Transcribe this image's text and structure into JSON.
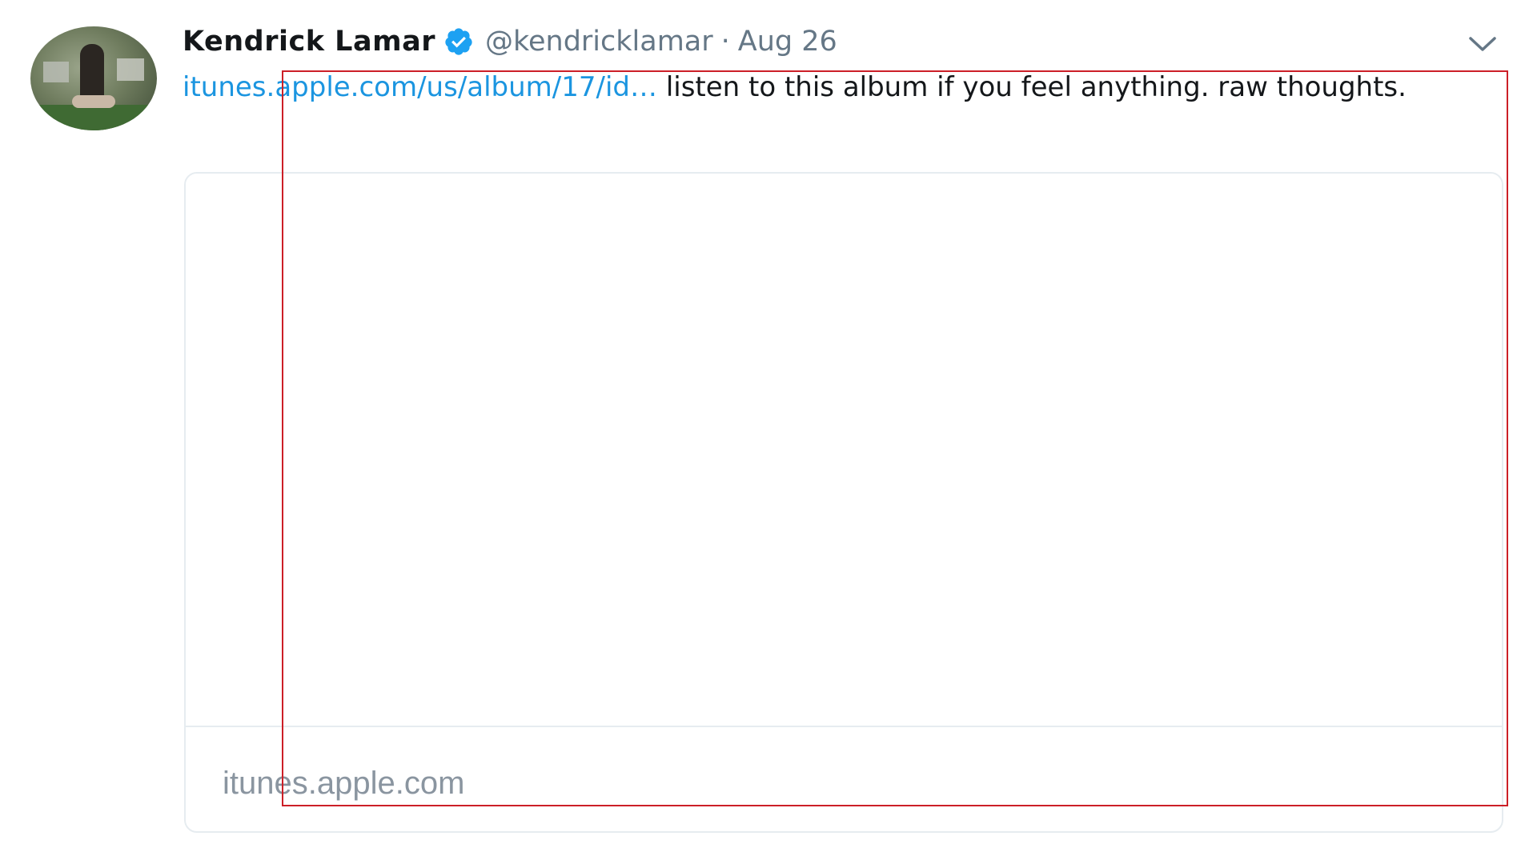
{
  "tweet": {
    "author_name": "Kendrick Lamar",
    "verified_icon": "verified-badge-icon",
    "handle": "@kendricklamar",
    "separator": "·",
    "date": "Aug 26",
    "caret_icon": "chevron-down-icon",
    "link_text": "itunes.apple.com/us/album/17/id…",
    "body_text": " listen to this album if you feel anything. raw thoughts.",
    "card": {
      "domain": "itunes.apple.com"
    }
  },
  "colors": {
    "link": "#1b95e0",
    "verified": "#1da1f2",
    "highlight_box": "#cc1f27",
    "secondary_text": "#657786"
  }
}
